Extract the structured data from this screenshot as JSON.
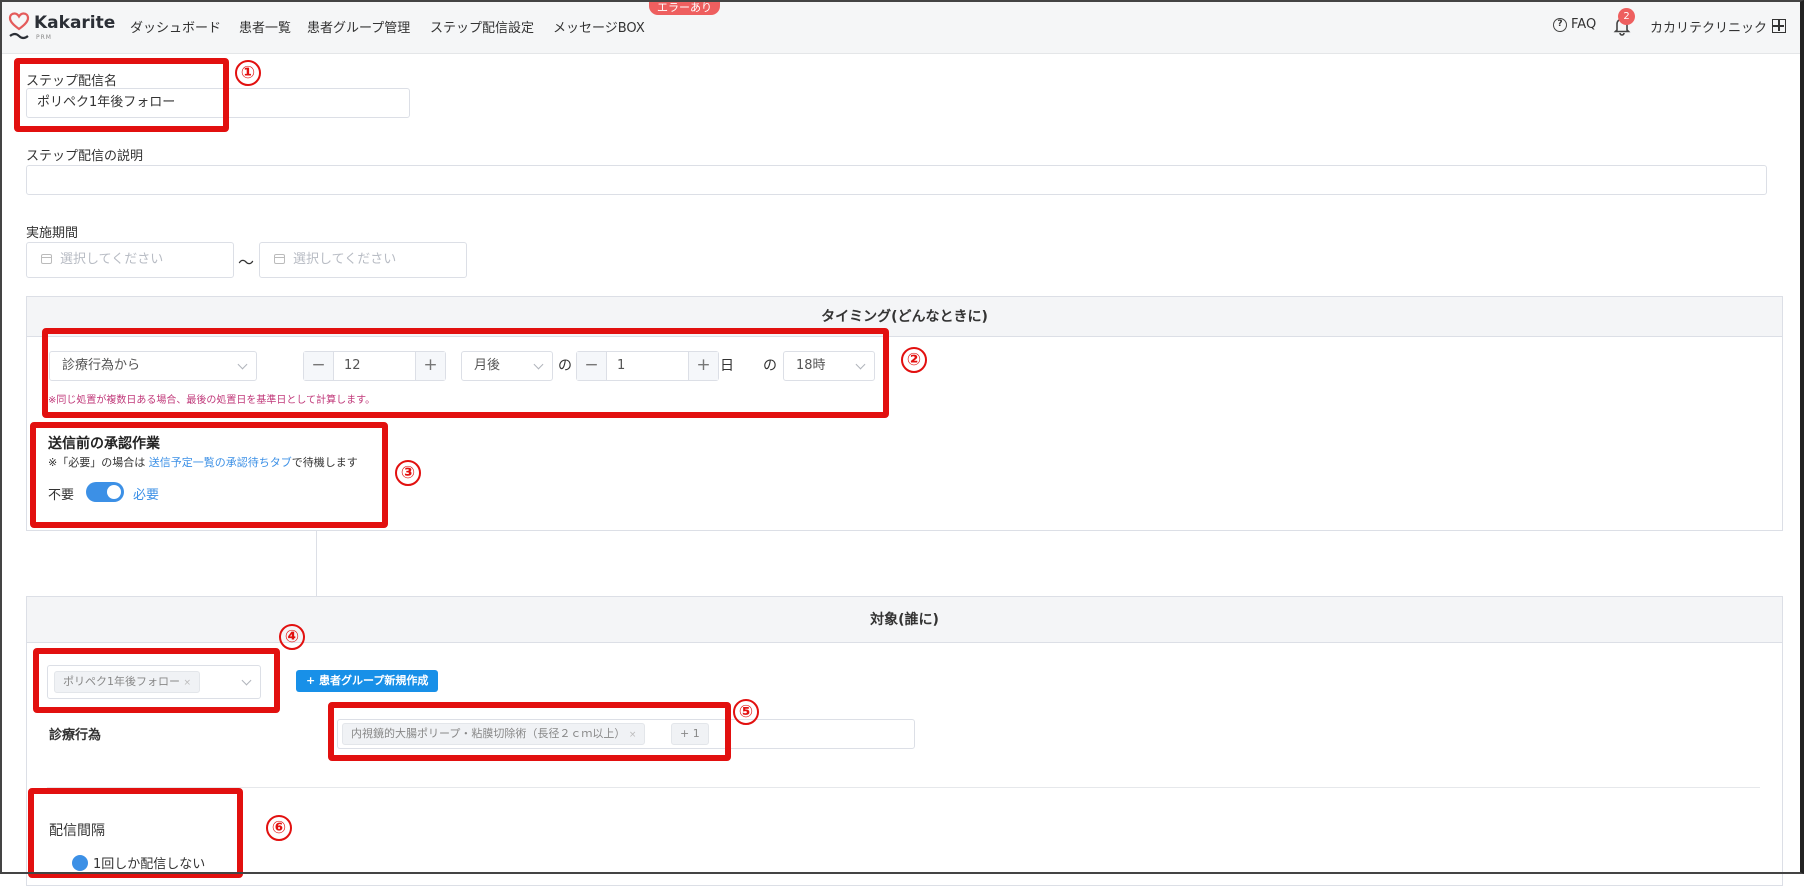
{
  "header": {
    "brand": "Kakarite",
    "brand_sub": "PRM",
    "nav": [
      "ダッシュボード",
      "患者一覧",
      "患者グループ管理",
      "ステップ配信設定",
      "メッセージBOX"
    ],
    "error_badge": "エラーあり",
    "faq_icon_text": "?",
    "faq": "FAQ",
    "notification_count": "2",
    "clinic_name": "カカリテクリニック"
  },
  "form": {
    "step_name_label": "ステップ配信名",
    "step_name_value": "ポリペク1年後フォロー",
    "description_label": "ステップ配信の説明",
    "description_value": "",
    "period_label": "実施期間",
    "period_start_placeholder": "選択してください",
    "period_tilde": "〜",
    "period_end_placeholder": "選択してください"
  },
  "timing": {
    "title": "タイミング(どんなときに)",
    "base_select": "診療行為から",
    "minus": "−",
    "plus": "+",
    "months_value": "12",
    "unit_select": "月後",
    "no1": "の",
    "day_value": "1",
    "day_label": "日",
    "no2": "の",
    "time_select": "18時",
    "note": "※同じ処置が複数日ある場合、最後の処置日を基準日として計算します。",
    "approval_title": "送信前の承認作業",
    "approval_note_pre": "※「必要」の場合は ",
    "approval_note_link": "送信予定一覧の承認待ちタブ",
    "approval_note_post": "で待機します",
    "toggle_off_label": "不要",
    "toggle_on_label": "必要",
    "toggle_on": true
  },
  "target": {
    "title": "対象(誰に)",
    "group_tag": "ポリペク1年後フォロー",
    "tag_close": "×",
    "new_group_button": "+ 患者グループ新規作成",
    "medical_label": "診療行為",
    "medical_tag": "内視鏡的大腸ポリープ・粘膜切除術（長径２ｃｍ以上）",
    "medical_more": "+ 1",
    "interval_label": "配信間隔",
    "interval_option": "1回しか配信しない"
  },
  "annotations": [
    "①",
    "②",
    "③",
    "④",
    "⑤",
    "⑥"
  ],
  "colors": {
    "accent": "#3c90e6",
    "annotation_red": "#e2100f",
    "error_badge": "#ee5f5f",
    "note_text": "#c0397a"
  }
}
